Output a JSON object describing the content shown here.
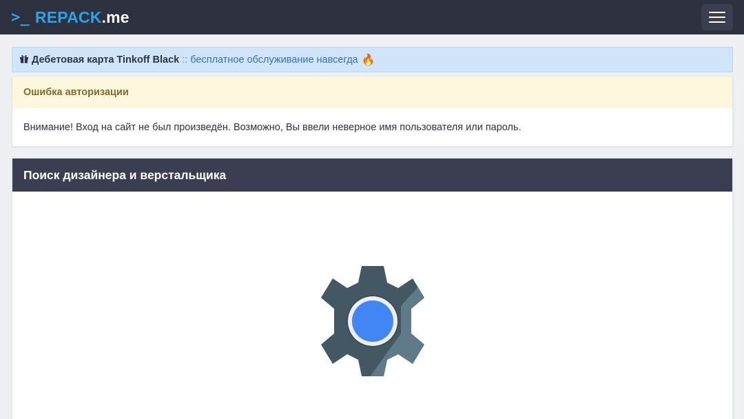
{
  "header": {
    "logo_prompt": ">_",
    "logo_brand": "REPACK",
    "logo_tld": ".me"
  },
  "promo": {
    "title": "Дебетовая карта Tinkoff Black",
    "separator": "::",
    "link_text": "бесплатное обслуживание навсегда",
    "fire_emoji": "🔥"
  },
  "alert": {
    "title": "Ошибка авторизации",
    "message": "Внимание! Вход на сайт не был произведён. Возможно, Вы ввели неверное имя пользователя или пароль."
  },
  "panel": {
    "title": "Поиск дизайнера и верстальщика"
  },
  "colors": {
    "topbar_bg": "#2e3140",
    "logo_blue": "#2aa3e8",
    "promo_bg": "#d0e5fa",
    "alert_head_bg": "#fdf7de",
    "panel_head_bg": "#3a3e50",
    "gear_dark": "#445864",
    "gear_light": "#607d8b",
    "gear_center": "#4285f4"
  },
  "icons": {
    "menu": "hamburger-menu-icon",
    "gift": "gift-icon",
    "fire": "fire-icon",
    "loading": "android-settings-gear-icon"
  }
}
